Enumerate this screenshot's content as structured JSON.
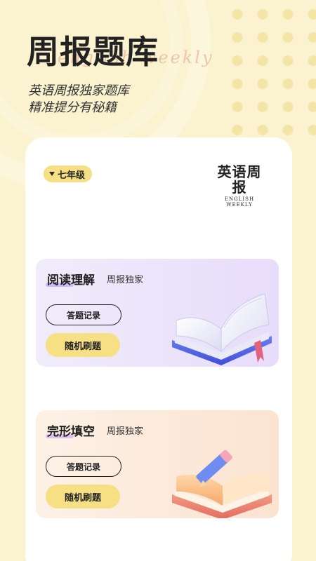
{
  "hero": {
    "title": "周报题库",
    "script": "english weekly",
    "subtitle_line1": "英语周报独家题库",
    "subtitle_line2": "精准提分有秘籍"
  },
  "card": {
    "grade": "七年级",
    "logo_cn": "英语周报",
    "logo_en": "ENGLISH WEEKLY"
  },
  "sections": [
    {
      "title": "阅读理解",
      "tag": "周报独家",
      "record_label": "答题记录",
      "practice_label": "随机刷题",
      "illustration": "open-book-icon"
    },
    {
      "title": "完形填空",
      "tag": "周报独家",
      "record_label": "答题记录",
      "practice_label": "随机刷题",
      "illustration": "books-pencil-icon"
    }
  ],
  "colors": {
    "background": "#fbf3cf",
    "accent_yellow": "#f7df84",
    "reading_bg": "#e7dcfb",
    "cloze_bg": "#fbe3d0"
  }
}
